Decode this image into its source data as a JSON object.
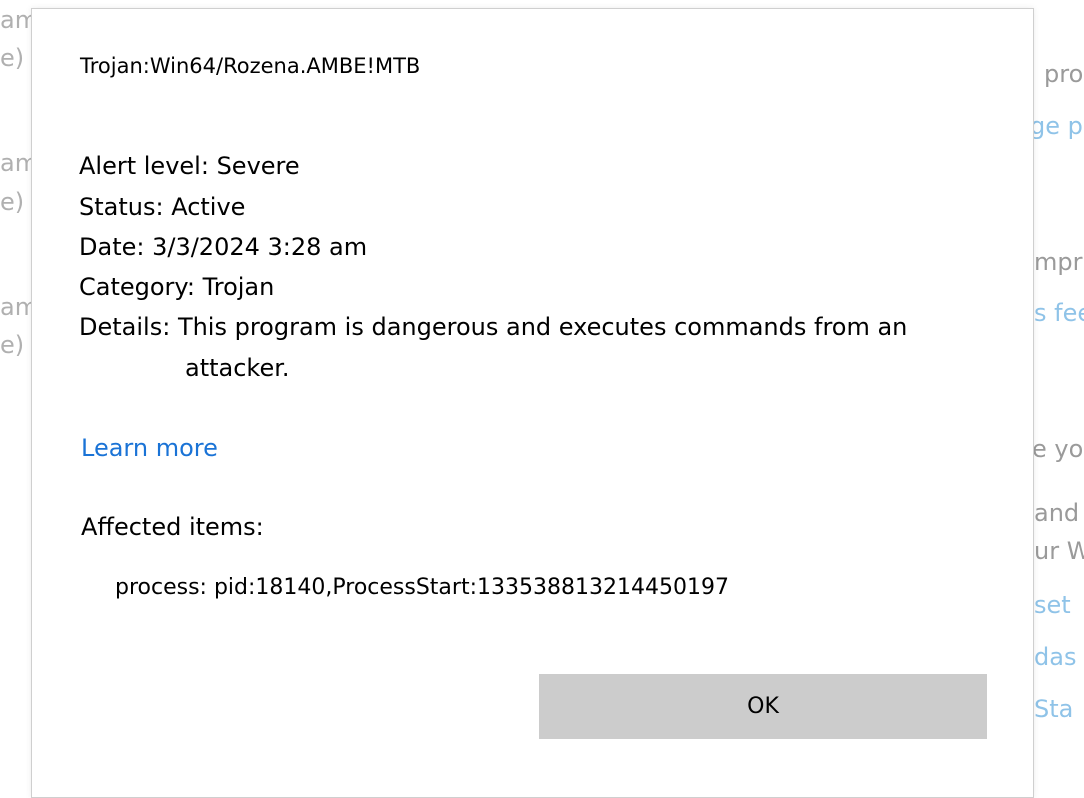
{
  "background": {
    "left_fragments": [
      "am",
      "e)",
      "am",
      "e)",
      "am",
      "e)"
    ],
    "right_fragments": [
      {
        "text": "pro",
        "kind": "gray"
      },
      {
        "text": "ge pr",
        "kind": "link"
      },
      {
        "text": "mpr",
        "kind": "gray"
      },
      {
        "text": "s fee",
        "kind": "link"
      },
      {
        "text": "e yo",
        "kind": "gray"
      },
      {
        "text": "and",
        "kind": "gray"
      },
      {
        "text": "ur W",
        "kind": "gray"
      },
      {
        "text": "set",
        "kind": "link"
      },
      {
        "text": "das",
        "kind": "link"
      },
      {
        "text": "Sta",
        "kind": "link"
      }
    ]
  },
  "dialog": {
    "threat_name": "Trojan:Win64/Rozena.AMBE!MTB",
    "details": {
      "alert_level_label": "Alert level:",
      "alert_level_value": "Severe",
      "status_label": "Status:",
      "status_value": "Active",
      "date_label": "Date:",
      "date_value": "3/3/2024 3:28 am",
      "category_label": "Category:",
      "category_value": "Trojan",
      "details_label": "Details:",
      "details_value_line1": "This program is dangerous and executes commands from an",
      "details_value_line2": "attacker."
    },
    "learn_more": "Learn more",
    "affected_items_label": "Affected items:",
    "affected_items": [
      "process: pid:18140,ProcessStart:133538813214450197"
    ],
    "ok_label": "OK"
  },
  "colors": {
    "link": "#1a73d6",
    "button_bg": "#cccccc"
  }
}
